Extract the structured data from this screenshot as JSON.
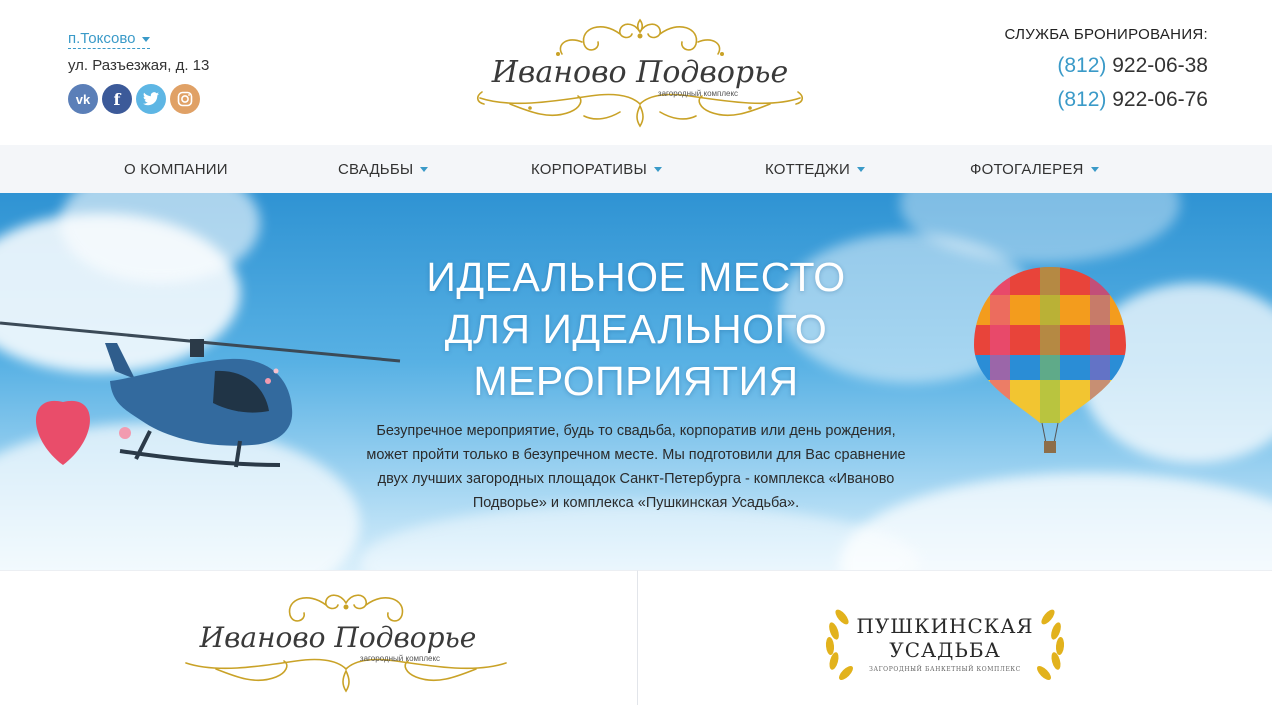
{
  "location": {
    "city": "п.Токсово",
    "address": "ул. Разъезжая, д. 13"
  },
  "socials": [
    {
      "icon": "vk-icon",
      "glyph": "vk"
    },
    {
      "icon": "facebook-icon",
      "glyph": "f"
    },
    {
      "icon": "twitter-icon",
      "glyph": "t"
    },
    {
      "icon": "instagram-icon",
      "glyph": "◎"
    }
  ],
  "logo": {
    "title": "Иваново Подворье",
    "subtitle": "загородный комплекс"
  },
  "booking": {
    "title": "СЛУЖБА БРОНИРОВАНИЯ:",
    "phones": [
      {
        "code": "(812)",
        "number": "922-06-38"
      },
      {
        "code": "(812)",
        "number": "922-06-76"
      }
    ]
  },
  "nav": [
    {
      "label": "О КОМПАНИИ",
      "dropdown": false
    },
    {
      "label": "СВАДЬБЫ",
      "dropdown": true
    },
    {
      "label": "КОРПОРАТИВЫ",
      "dropdown": true
    },
    {
      "label": "КОТТЕДЖИ",
      "dropdown": true
    },
    {
      "label": "ФОТОГАЛЕРЕЯ",
      "dropdown": true
    }
  ],
  "hero": {
    "title_lines": [
      "ИДЕАЛЬНОЕ МЕСТО",
      "ДЛЯ ИДЕАЛЬНОГО",
      "МЕРОПРИЯТИЯ"
    ],
    "text_lines": [
      "Безупречное мероприятие, будь то свадьба, корпоратив или день рождения,",
      "может пройти только в безупречном месте. Мы подготовили для Вас сравнение",
      "двух лучших загородных площадок Санкт-Петербурга - комплекса «Иваново",
      "Подворье» и комплекса «Пушкинская Усадьба»."
    ]
  },
  "cards": {
    "left": {
      "title": "Иваново Подворье",
      "subtitle": "загородный комплекс"
    },
    "right": {
      "title_line1": "ПУШКИНСКАЯ",
      "title_line2": "УСАДЬБА",
      "subtitle": "ЗАГОРОДНЫЙ БАНКЕТНЫЙ КОМПЛЕКС"
    }
  },
  "colors": {
    "accent": "#3a9ac8",
    "gold": "#c9a227",
    "nav_bg": "#f4f6f9"
  }
}
